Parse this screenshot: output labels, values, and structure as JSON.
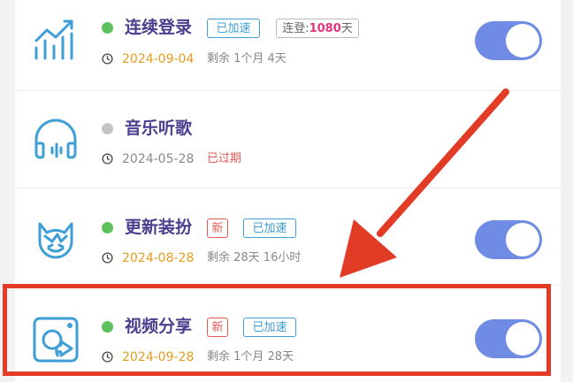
{
  "colors": {
    "title": "#4a3f8f",
    "active_dot": "#5dc25d",
    "inactive_dot": "#c4c4c4",
    "date_active": "#e69c1f",
    "date_inactive": "#8a8a8a",
    "speed_tag": "#3e9fd6",
    "new_tag": "#e05a55",
    "streak_number": "#e5347b",
    "toggle_on": "#6f8be3",
    "annotation": "#e23c27",
    "icon_stroke": "#3e9fd6"
  },
  "privileges": [
    {
      "name": "连续登录",
      "icon": "chart-trend-icon",
      "active": true,
      "new_tag": false,
      "speed_tag": "已加速",
      "streak_prefix": "连登:",
      "streak_value": "1080",
      "streak_suffix": "天",
      "date": "2024-09-04",
      "remaining": "剩余 1个月 4天",
      "toggle_on": true
    },
    {
      "name": "音乐听歌",
      "icon": "headphones-icon",
      "active": false,
      "date": "2024-05-28",
      "status": "已过期",
      "toggle_on": false
    },
    {
      "name": "更新装扮",
      "icon": "cat-avatar-icon",
      "active": true,
      "new_tag": "新",
      "speed_tag": "已加速",
      "date": "2024-08-28",
      "remaining": "剩余 28天 16小时",
      "toggle_on": true
    },
    {
      "name": "视频分享",
      "icon": "video-share-icon",
      "active": true,
      "new_tag": "新",
      "speed_tag": "已加速",
      "date": "2024-09-28",
      "remaining": "剩余 1个月 28天",
      "toggle_on": true
    }
  ]
}
